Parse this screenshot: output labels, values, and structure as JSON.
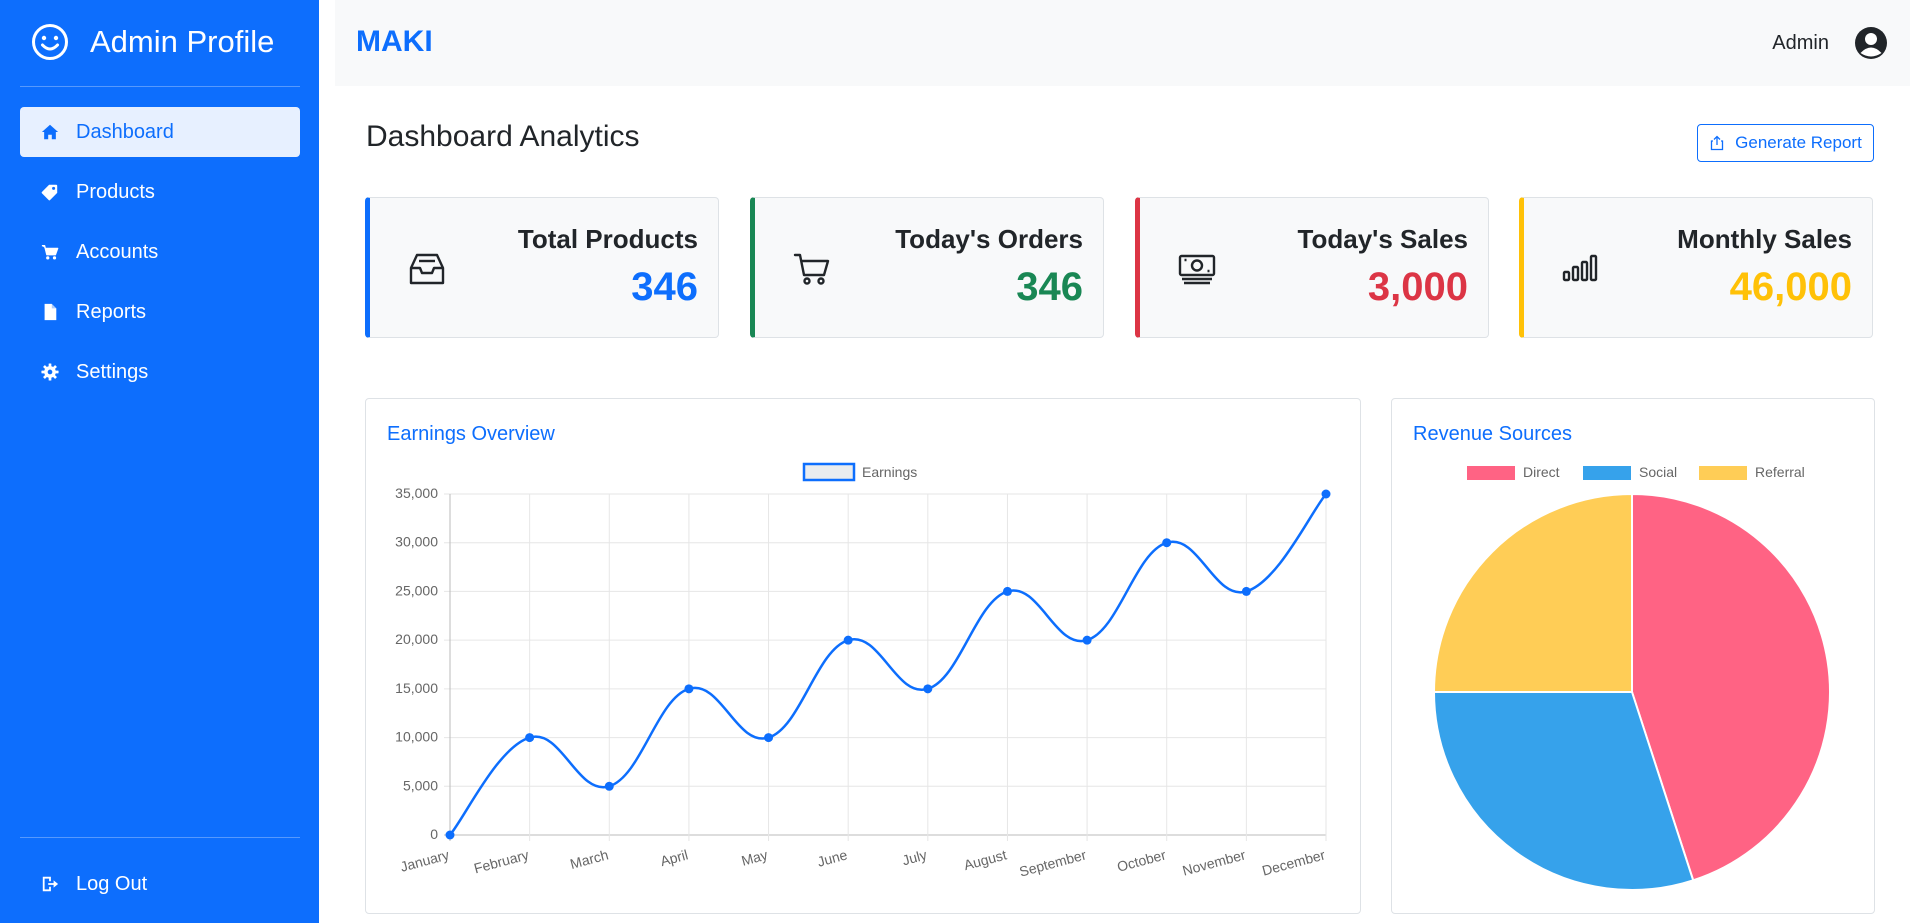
{
  "sidebar": {
    "title": "Admin Profile",
    "items": [
      {
        "label": "Dashboard",
        "icon": "home-icon",
        "active": true
      },
      {
        "label": "Products",
        "icon": "tag-icon"
      },
      {
        "label": "Accounts",
        "icon": "cart-icon"
      },
      {
        "label": "Reports",
        "icon": "file-icon"
      },
      {
        "label": "Settings",
        "icon": "gear-icon"
      }
    ],
    "logout_label": "Log Out"
  },
  "header": {
    "logo": "MAKI",
    "user": "Admin"
  },
  "main": {
    "title": "Dashboard Analytics",
    "report_button": "Generate Report",
    "stats": [
      {
        "label": "Total Products",
        "value": "346",
        "color": "#0d6efd",
        "icon": "inbox-icon"
      },
      {
        "label": "Today's Orders",
        "value": "346",
        "color": "#198754",
        "icon": "cart-icon"
      },
      {
        "label": "Today's Sales",
        "value": "3,000",
        "color": "#dc3545",
        "icon": "cash-icon"
      },
      {
        "label": "Monthly Sales",
        "value": "46,000",
        "color": "#ffc107",
        "icon": "bar-chart-icon"
      }
    ],
    "earnings_title": "Earnings Overview",
    "revenue_title": "Revenue Sources"
  },
  "colors": {
    "primary": "#0d6efd",
    "success": "#198754",
    "danger": "#dc3545",
    "warning": "#ffc107"
  },
  "chart_data": [
    {
      "type": "line",
      "categories": [
        "January",
        "February",
        "March",
        "April",
        "May",
        "June",
        "July",
        "August",
        "September",
        "October",
        "November",
        "December"
      ],
      "series": [
        {
          "name": "Earnings",
          "values": [
            0,
            10000,
            5000,
            15000,
            10000,
            20000,
            15000,
            25000,
            20000,
            30000,
            25000,
            35000
          ],
          "color": "#0d6efd"
        }
      ],
      "ylim": [
        0,
        35000
      ],
      "yticks": [
        0,
        5000,
        10000,
        15000,
        20000,
        25000,
        30000,
        35000
      ],
      "ytick_labels": [
        "0",
        "5,000",
        "10,000",
        "15,000",
        "20,000",
        "25,000",
        "30,000",
        "35,000"
      ],
      "grid": true,
      "legend": "top"
    },
    {
      "type": "pie",
      "categories": [
        "Direct",
        "Social",
        "Referral"
      ],
      "values": [
        45,
        30,
        25
      ],
      "colors": [
        "#ff6384",
        "#36a2eb",
        "#ffcd56"
      ],
      "legend": "top"
    }
  ]
}
